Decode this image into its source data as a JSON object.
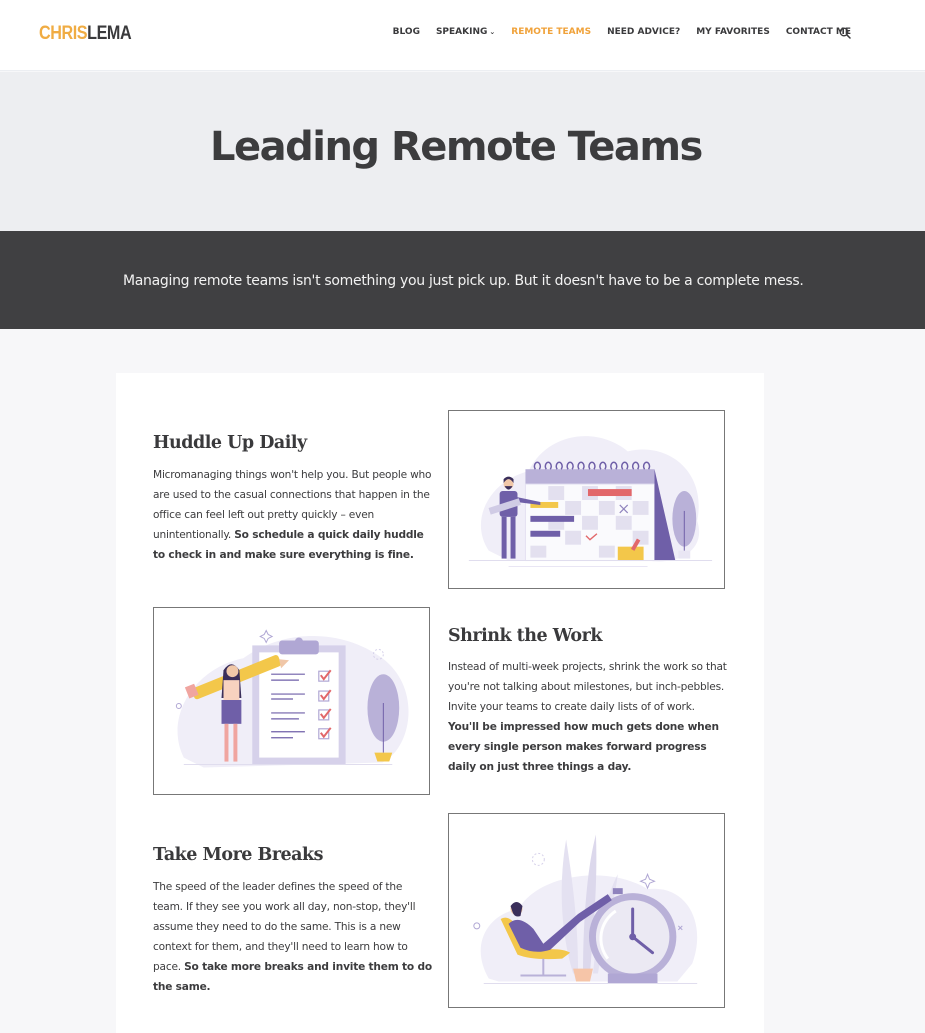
{
  "header": {
    "logo_part1": "CHRIS",
    "logo_part2": "LEMA",
    "nav": [
      {
        "label": "BLOG",
        "active": false
      },
      {
        "label": "SPEAKING",
        "active": false,
        "has_dropdown": true
      },
      {
        "label": "REMOTE TEAMS",
        "active": true
      },
      {
        "label": "NEED ADVICE?",
        "active": false
      },
      {
        "label": "MY FAVORITES",
        "active": false
      },
      {
        "label": "CONTACT ME",
        "active": false
      }
    ],
    "search_icon": "search-icon",
    "dropdown_icon": "⌄"
  },
  "hero": {
    "title": "Leading Remote Teams"
  },
  "intro": {
    "text": "Managing remote teams isn't something you just pick up. But it doesn't have to be a complete mess."
  },
  "sections": [
    {
      "title": "Huddle Up Daily",
      "body": "Micromanaging things won't help you. But people who are used to the casual connections that happen in the office can feel left out pretty quickly – even unintentionally. ",
      "bold": "So schedule a quick daily huddle to check in and make sure everything is fine.",
      "illustration": "calendar-planning-illustration"
    },
    {
      "title": "Shrink the Work",
      "body": "Instead of multi-week projects, shrink the work so that you're not talking about milestones, but inch-pebbles. Invite your teams to create daily lists of of work. ",
      "bold": "You'll be impressed how much gets done when every single person makes forward progress daily on just three things a day.",
      "illustration": "checklist-clipboard-illustration"
    },
    {
      "title": "Take More Breaks",
      "body": "The speed of the leader defines the speed of the team. If they see you work all day, non-stop, they'll assume they need to do the same. This is a new context for them, and they'll need to learn how to pace. ",
      "bold": "So take more breaks and invite them to do the same.",
      "illustration": "relaxing-clock-illustration"
    }
  ],
  "colors": {
    "accent": "#f0a23a",
    "dark": "#3a3a3c",
    "band": "#404042",
    "purple": "#6f5fa8",
    "lavender": "#e9e6f4",
    "yellow": "#f3c74a",
    "red": "#e2676a"
  }
}
